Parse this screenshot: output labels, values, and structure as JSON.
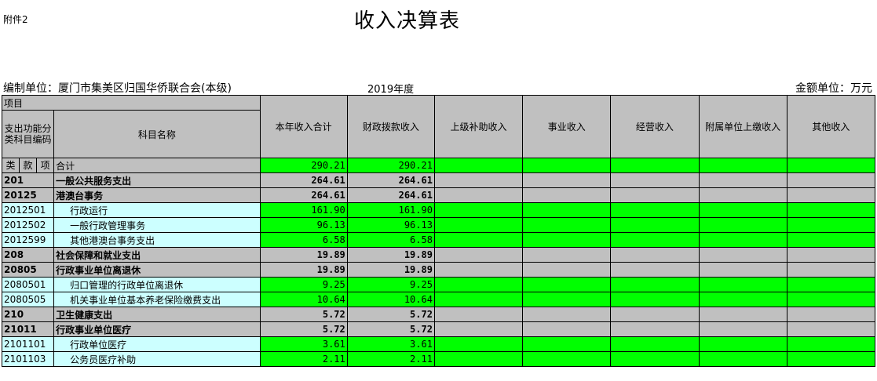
{
  "attachment_label": "附件2",
  "title": "收入决算表",
  "unit_left": "编制单位：厦门市集美区归国华侨联合会(本级)",
  "year": "2019年度",
  "unit_right": "金额单位：万元",
  "headers": {
    "project": "项目",
    "code": "支出功能分类科目编码",
    "subject": "科目名称",
    "type_labels": [
      "类",
      "款",
      "项"
    ],
    "total_label": "合计",
    "columns": [
      "本年收入合计",
      "财政拨款收入",
      "上级补助收入",
      "事业收入",
      "经营收入",
      "附属单位上缴收入",
      "其他收入"
    ]
  },
  "totals": {
    "annual": "290.21",
    "fiscal": "290.21"
  },
  "rows": [
    {
      "code": "201",
      "name": "一般公共服务支出",
      "annual": "264.61",
      "fiscal": "264.61",
      "level": "category"
    },
    {
      "code": "20125",
      "name": "港澳台事务",
      "annual": "264.61",
      "fiscal": "264.61",
      "level": "category"
    },
    {
      "code": "2012501",
      "name": "行政运行",
      "annual": "161.90",
      "fiscal": "161.90",
      "level": "item"
    },
    {
      "code": "2012502",
      "name": "一般行政管理事务",
      "annual": "96.13",
      "fiscal": "96.13",
      "level": "item"
    },
    {
      "code": "2012599",
      "name": "其他港澳台事务支出",
      "annual": "6.58",
      "fiscal": "6.58",
      "level": "item"
    },
    {
      "code": "208",
      "name": "社会保障和就业支出",
      "annual": "19.89",
      "fiscal": "19.89",
      "level": "category"
    },
    {
      "code": "20805",
      "name": "行政事业单位离退休",
      "annual": "19.89",
      "fiscal": "19.89",
      "level": "category"
    },
    {
      "code": "2080501",
      "name": "归口管理的行政单位离退休",
      "annual": "9.25",
      "fiscal": "9.25",
      "level": "item"
    },
    {
      "code": "2080505",
      "name": "机关事业单位基本养老保险缴费支出",
      "annual": "10.64",
      "fiscal": "10.64",
      "level": "item"
    },
    {
      "code": "210",
      "name": "卫生健康支出",
      "annual": "5.72",
      "fiscal": "5.72",
      "level": "category"
    },
    {
      "code": "21011",
      "name": "行政事业单位医疗",
      "annual": "5.72",
      "fiscal": "5.72",
      "level": "category"
    },
    {
      "code": "2101101",
      "name": "行政单位医疗",
      "annual": "3.61",
      "fiscal": "3.61",
      "level": "item"
    },
    {
      "code": "2101103",
      "name": "公务员医疗补助",
      "annual": "2.11",
      "fiscal": "2.11",
      "level": "item"
    }
  ]
}
